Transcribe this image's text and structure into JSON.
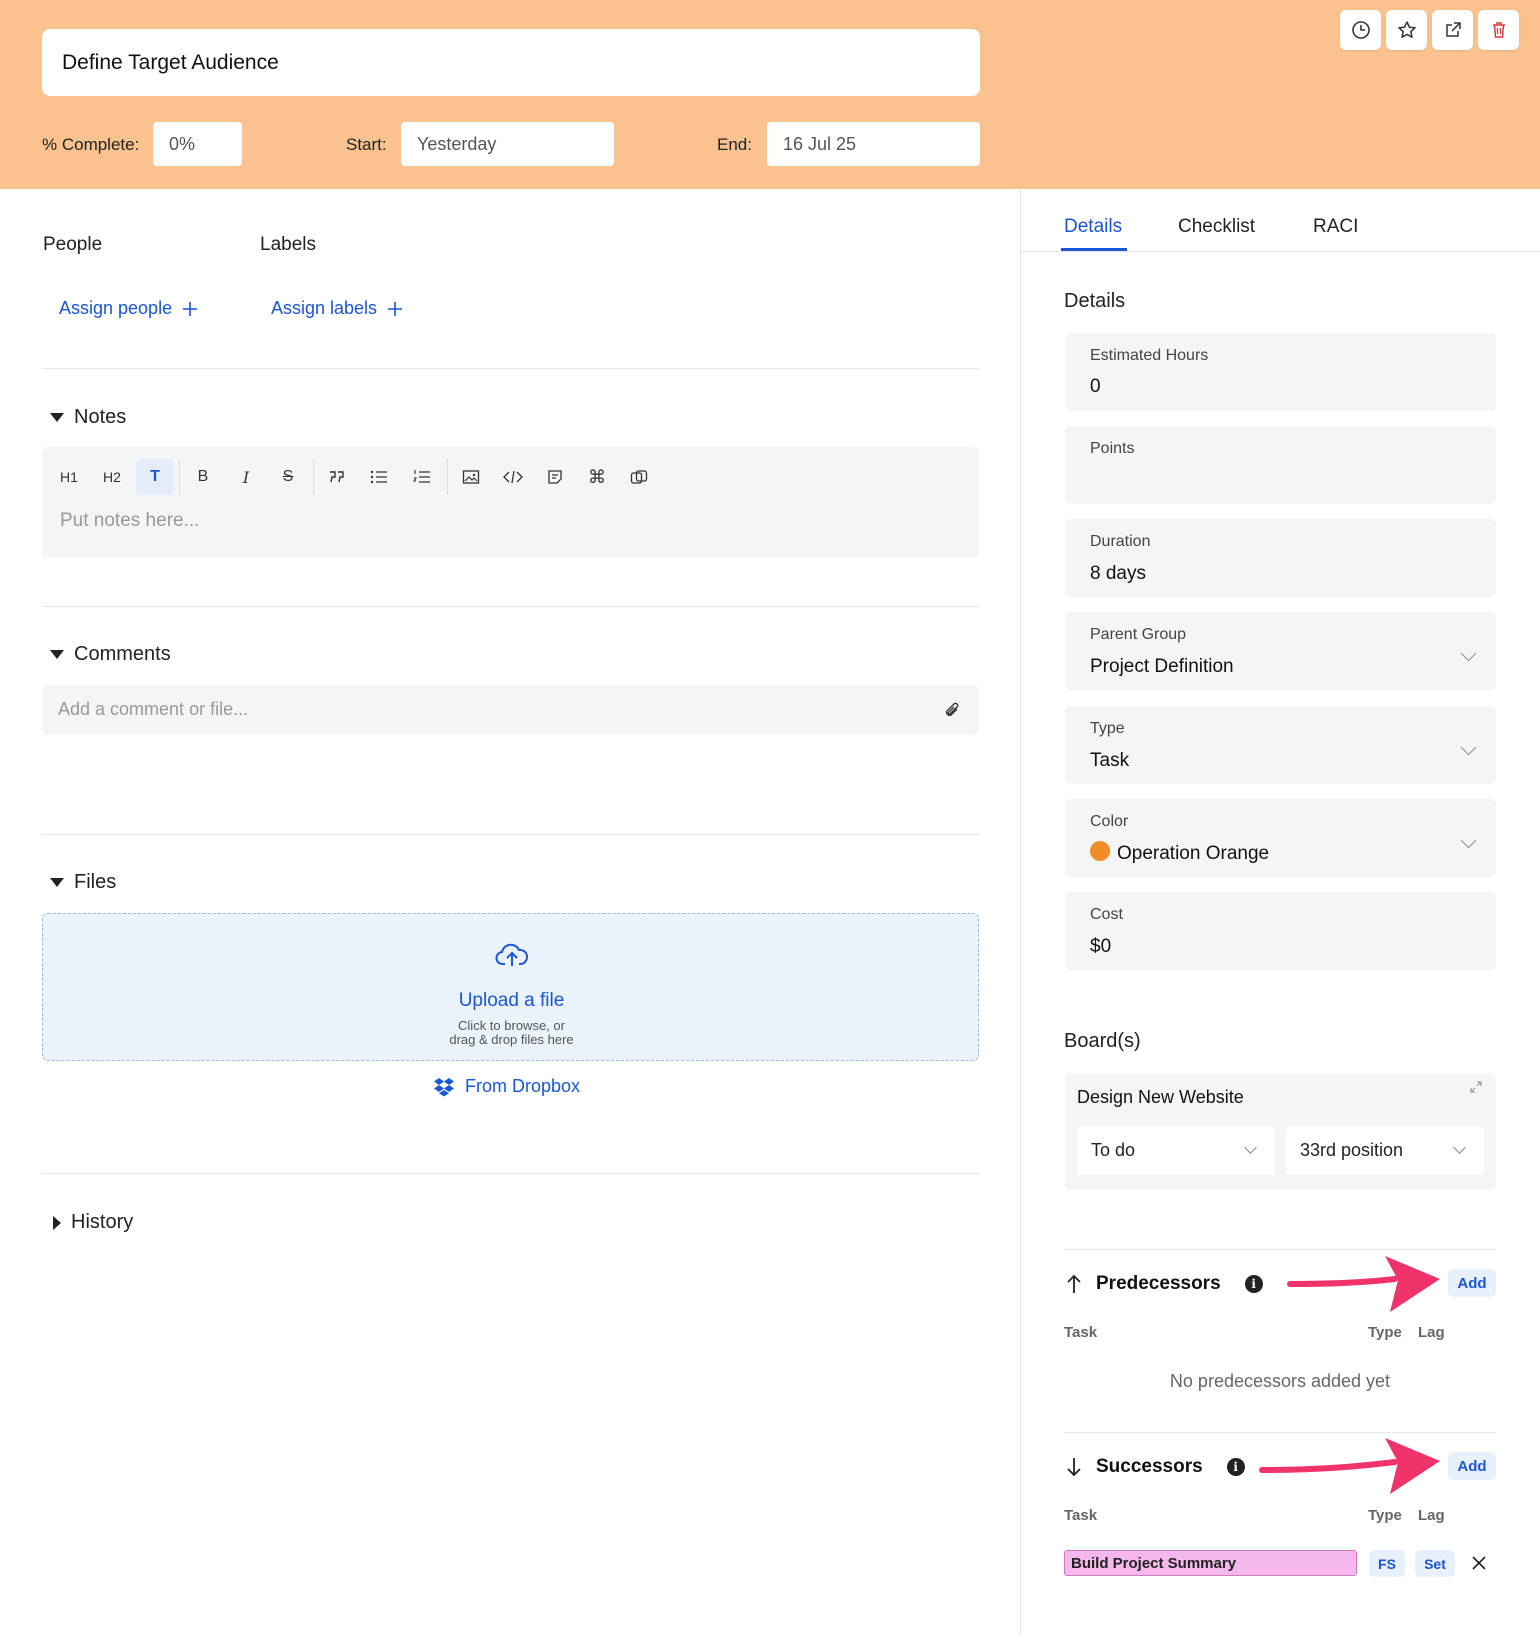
{
  "header": {
    "task_title": "Define Target Audience",
    "percent_label": "% Complete:",
    "percent_value": "0%",
    "start_label": "Start:",
    "start_value": "Yesterday",
    "end_label": "End:",
    "end_value": "16 Jul 25",
    "bg_color": "#fac28e",
    "actions": [
      "clock-icon",
      "star-icon",
      "external-link-icon",
      "trash-icon"
    ]
  },
  "people": {
    "label": "People",
    "link": "Assign people"
  },
  "labels": {
    "label": "Labels",
    "link": "Assign labels"
  },
  "notes": {
    "title": "Notes",
    "placeholder": "Put notes here...",
    "toolbar": [
      "H1",
      "H2",
      "T",
      "B",
      "I",
      "S"
    ]
  },
  "comments": {
    "title": "Comments",
    "placeholder": "Add a comment or file..."
  },
  "files": {
    "title": "Files",
    "upload_title": "Upload a file",
    "upload_hint_1": "Click to browse, or",
    "upload_hint_2": "drag & drop files here",
    "dropbox": "From Dropbox"
  },
  "history": {
    "title": "History"
  },
  "tabs": [
    "Details",
    "Checklist",
    "RACI"
  ],
  "details": {
    "heading": "Details",
    "estimated_hours": {
      "label": "Estimated Hours",
      "value": "0"
    },
    "points": {
      "label": "Points",
      "value": ""
    },
    "duration": {
      "label": "Duration",
      "value": "8 days"
    },
    "parent_group": {
      "label": "Parent Group",
      "value": "Project Definition"
    },
    "type": {
      "label": "Type",
      "value": "Task"
    },
    "color": {
      "label": "Color",
      "value": "Operation Orange",
      "swatch": "#f28c28"
    },
    "cost": {
      "label": "Cost",
      "value": "$0"
    }
  },
  "boards": {
    "heading": "Board(s)",
    "board_name": "Design New Website",
    "status": "To do",
    "position": "33rd position"
  },
  "predecessors": {
    "title": "Predecessors",
    "add": "Add",
    "col_task": "Task",
    "col_type": "Type",
    "col_lag": "Lag",
    "empty": "No predecessors added yet"
  },
  "successors": {
    "title": "Successors",
    "add": "Add",
    "col_task": "Task",
    "col_type": "Type",
    "col_lag": "Lag",
    "rows": [
      {
        "task": "Build Project Summary",
        "type": "FS",
        "lag": "Set",
        "task_color": "#f5b8ec"
      }
    ]
  },
  "accent_color": "#1a56d6",
  "annotation_color": "#f0336b"
}
